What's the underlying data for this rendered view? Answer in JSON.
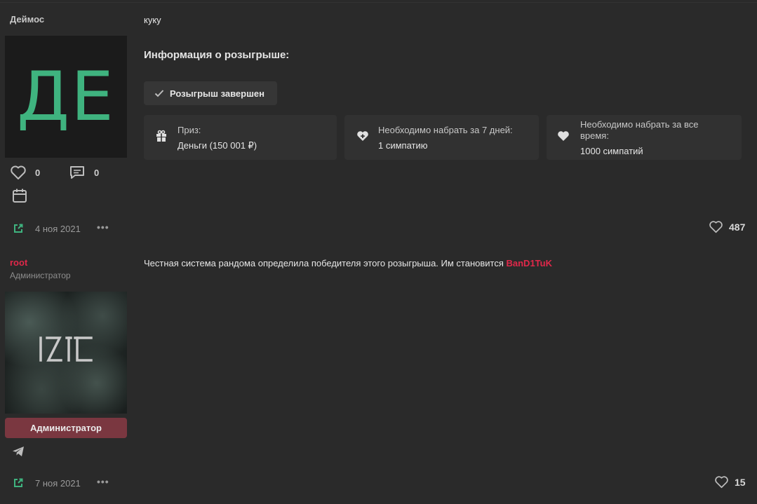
{
  "posts": [
    {
      "username": "Деймос",
      "avatar_initials": "ДЕ",
      "likes_count": "0",
      "messages_count": "0",
      "date": "4 ноя 2021",
      "message": "куку",
      "giveaway": {
        "title": "Информация о розыгрыше:",
        "status": "Розыгрыш завершен",
        "cards": [
          {
            "label": "Приз:",
            "value": "Деньги (150 001 ₽)",
            "icon": "gift-icon"
          },
          {
            "label": "Необходимо набрать за 7 дней:",
            "value": "1 симпатию",
            "icon": "heart-plus-icon"
          },
          {
            "label": "Необходимо набрать за все время:",
            "value": "1000 симпатий",
            "icon": "heart-icon"
          }
        ]
      },
      "reactions": "487"
    },
    {
      "username": "root",
      "user_title": "Администратор",
      "banner": "Администратор",
      "date": "7 ноя 2021",
      "message": "Честная система рандома определила победителя этого розыгрыша. Им становится ",
      "winner": "BanD1TuK",
      "reactions": "15"
    }
  ],
  "colors": {
    "background": "#2a2a2a",
    "card": "#313131",
    "accent_green": "#3fb37f",
    "admin_red": "#e0284a",
    "banner": "#7a3740"
  }
}
